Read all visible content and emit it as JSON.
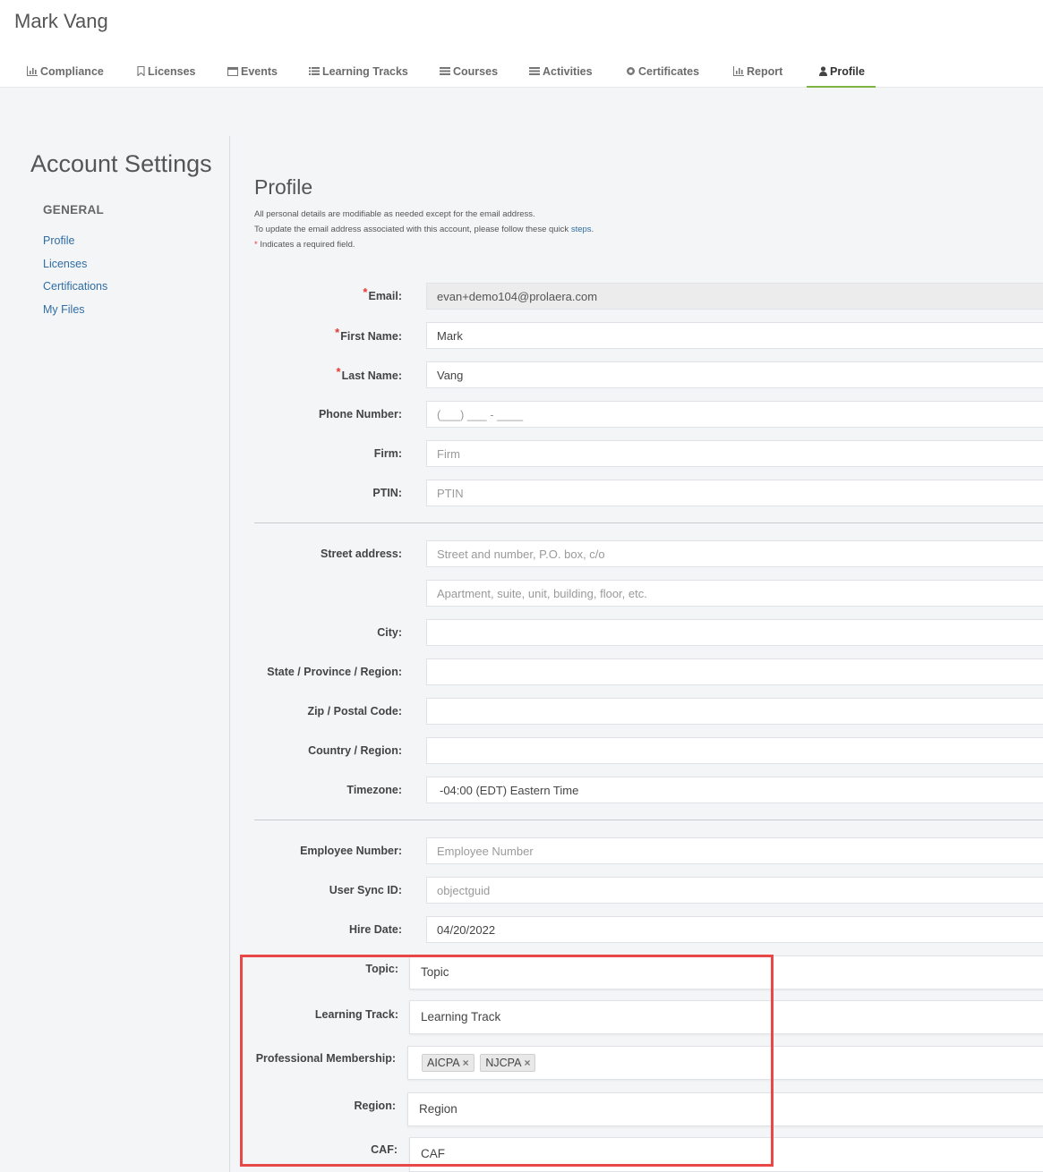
{
  "header": {
    "user_name": "Mark Vang",
    "nav": [
      {
        "label": "Compliance",
        "icon": "bar-chart-icon",
        "active": false
      },
      {
        "label": "Licenses",
        "icon": "bookmark-icon",
        "active": false
      },
      {
        "label": "Events",
        "icon": "calendar-icon",
        "active": false
      },
      {
        "label": "Learning Tracks",
        "icon": "list-icon",
        "active": false
      },
      {
        "label": "Courses",
        "icon": "courses-icon",
        "active": false
      },
      {
        "label": "Activities",
        "icon": "activities-icon",
        "active": false
      },
      {
        "label": "Certificates",
        "icon": "certificate-icon",
        "active": false
      },
      {
        "label": "Report",
        "icon": "report-chart-icon",
        "active": false
      },
      {
        "label": "Profile",
        "icon": "user-icon",
        "active": true
      }
    ]
  },
  "sidebar": {
    "title": "Account Settings",
    "section": "GENERAL",
    "links": [
      "Profile",
      "Licenses",
      "Certifications",
      "My Files"
    ]
  },
  "profile": {
    "title": "Profile",
    "info1": "All personal details are modifiable as needed except for the email address.",
    "info2": "To update the email address associated with this account, please follow these quick ",
    "info2_link": "steps",
    "info2_end": ".",
    "info3_star": "*",
    "info3": " Indicates a required field.",
    "fields": {
      "email": {
        "label": "Email:",
        "value": "evan+demo104@prolaera.com"
      },
      "first_name": {
        "label": "First Name:",
        "value": "Mark"
      },
      "last_name": {
        "label": "Last Name:",
        "value": "Vang"
      },
      "phone": {
        "label": "Phone Number:",
        "placeholder": "(___) ___ - ____"
      },
      "firm": {
        "label": "Firm:",
        "placeholder": "Firm"
      },
      "ptin": {
        "label": "PTIN:",
        "placeholder": "PTIN"
      },
      "street": {
        "label": "Street address:",
        "placeholder": "Street and number, P.O. box, c/o"
      },
      "street2": {
        "placeholder": "Apartment, suite, unit, building, floor, etc."
      },
      "city": {
        "label": "City:",
        "value": ""
      },
      "state": {
        "label": "State / Province / Region:",
        "value": ""
      },
      "zip": {
        "label": "Zip / Postal Code:",
        "value": ""
      },
      "country": {
        "label": "Country / Region:",
        "value": ""
      },
      "timezone": {
        "label": "Timezone:",
        "value": "-04:00 (EDT) Eastern Time"
      },
      "employee_number": {
        "label": "Employee Number:",
        "placeholder": "Employee Number"
      },
      "user_sync_id": {
        "label": "User Sync ID:",
        "placeholder": "objectguid"
      },
      "hire_date": {
        "label": "Hire Date:",
        "value": "04/20/2022"
      },
      "topic": {
        "label": "Topic:",
        "value": "Topic"
      },
      "learning_track": {
        "label": "Learning Track:",
        "value": "Learning Track"
      },
      "membership": {
        "label": "Professional Membership:",
        "tags": [
          "AICPA",
          "NJCPA"
        ]
      },
      "region": {
        "label": "Region:",
        "value": "Region"
      },
      "caf": {
        "label": "CAF:",
        "value": "CAF"
      }
    }
  },
  "colors": {
    "active_tab_underline": "#7cb342",
    "link": "#2f6da4",
    "required": "#e53935",
    "highlight": "#e84848",
    "content_bg": "#f4f5f7"
  }
}
